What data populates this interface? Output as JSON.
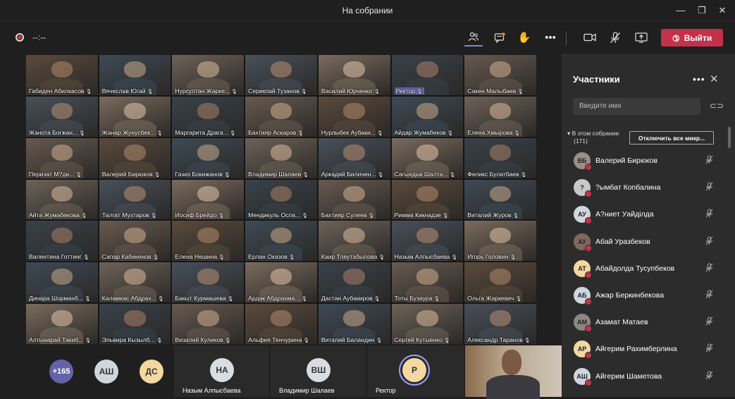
{
  "window": {
    "title": "На собрании",
    "minimize": "—",
    "maximize": "❐",
    "close": "✕"
  },
  "toolbar": {
    "timer": "--:--",
    "leave_label": "Выйти"
  },
  "grid": [
    [
      "Габиден Абилкасов",
      "Вячеслав Югай",
      "Нурсултан Жарке...",
      "Серикпай Тузанов",
      "Василий Юрченко",
      "Ректор",
      "Сакен Малыбаев"
    ],
    [
      "Жанота Богжан...",
      "Жанар Жунусбек...",
      "Маргарита Драга...",
      "Бахтияр Аскаров",
      "Нурлыбек Аубаки...",
      "Айдар Жумабеков",
      "Елена Хмырова"
    ],
    [
      "Перизат М?ди...",
      "Валерий Бирюков",
      "Газиз Бокижанов",
      "Владимир Шалаев",
      "Аркадий Биличен...",
      "Сагындык Шалта...",
      "Феликс Булатбаев"
    ],
    [
      "Айта Жумабекова",
      "Талгат Мухтаров",
      "Иосиф Брейдо",
      "Мендикуль Оспа...",
      "Бахтияр Сулеев",
      "Римма Кикнадзе",
      "Виталий Журов"
    ],
    [
      "Валентина Готтинг",
      "Сапар Кабикенов",
      "Елена Нешина",
      "Ерлан Оказов",
      "Каир Тлеутабылова",
      "Назым Алпысбаева",
      "Игорь Головин"
    ],
    [
      "Динара Шорманб...",
      "Каламкас Абдрах...",
      "Бакыт Курмашева",
      "Ардак Абдрахма...",
      "Дастан Аубакиров",
      "Тоты Бузаура",
      "Ольга Жаркевич"
    ],
    [
      "Алтынарай Такиб...",
      "Эльвира Кызылб...",
      "Визалий Куликов",
      "Альфия Тенчурина",
      "Виталий Баландин",
      "Сергей Кутыенко",
      "Александр Таранов"
    ]
  ],
  "bottom": {
    "overflow_count": "+165",
    "avatars": [
      {
        "initials": "АШ",
        "color": "#cfd6dd"
      },
      {
        "initials": "ДС",
        "color": "#f4d8a1"
      }
    ],
    "tiles": [
      {
        "initials": "НА",
        "name": "Назым Алпысбаева",
        "color": "#d9dde2"
      },
      {
        "initials": "ВШ",
        "name": "Владимир Шалаев",
        "color": "#d9dde2"
      },
      {
        "initials": "Р",
        "name": "Ректор",
        "color": "#f4d8a1"
      }
    ]
  },
  "panel": {
    "title": "Участники",
    "search_placeholder": "Введите имя",
    "section_label": "В этом собрании",
    "section_count": "(171)",
    "mute_all_label": "Отключить все микр...",
    "participants": [
      {
        "initials": "ВБ",
        "name": "Валерий Бирюков",
        "color": "#9a8f86"
      },
      {
        "initials": "?",
        "name": "?ымбат Копбалина",
        "color": "#c8c8c8"
      },
      {
        "initials": "АУ",
        "name": "А?ниет Уайділда",
        "color": "#cfd6dd"
      },
      {
        "initials": "АУ",
        "name": "Абай Уразбеков",
        "color": "#7c6a5c"
      },
      {
        "initials": "АТ",
        "name": "Абайдолда Тусупбеков",
        "color": "#f4d8a1"
      },
      {
        "initials": "АБ",
        "name": "Ажар Беркинбекова",
        "color": "#cfd6dd"
      },
      {
        "initials": "АМ",
        "name": "Азамат Матаев",
        "color": "#8c8782"
      },
      {
        "initials": "АР",
        "name": "Айгерим Рахимберлина",
        "color": "#f4d8a1"
      },
      {
        "initials": "АШ",
        "name": "Айгерим Шаметова",
        "color": "#cfd6dd"
      }
    ]
  }
}
